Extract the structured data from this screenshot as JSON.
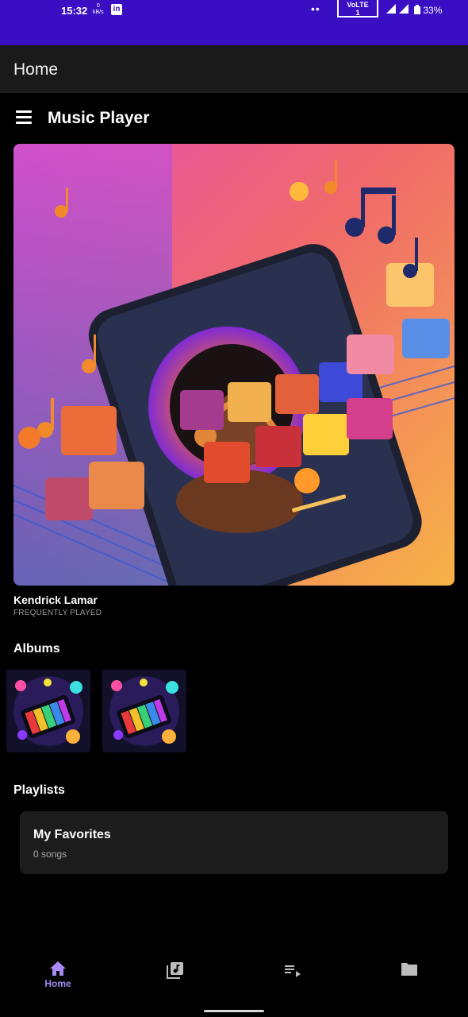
{
  "status_bar": {
    "time": "15:32",
    "net_speed_value": "0",
    "net_speed_unit": "kB/s",
    "app_icon": "linkedin-icon",
    "volte_label": "VoLTE",
    "volte_sim": "1",
    "battery": "33%",
    "color": "#3a0fc4"
  },
  "app_bar": {
    "title": "Home"
  },
  "header": {
    "menu_icon": "menu-icon",
    "title": "Music Player"
  },
  "featured": {
    "artist": "Kendrick Lamar",
    "subtitle": "FREQUENTLY PLAYED"
  },
  "albums": {
    "title": "Albums",
    "items": [
      {
        "cover": "album-art"
      },
      {
        "cover": "album-art"
      }
    ]
  },
  "playlists": {
    "title": "Playlists",
    "items": [
      {
        "name": "My Favorites",
        "count": "0 songs"
      }
    ]
  },
  "bottom_nav": {
    "items": [
      {
        "icon": "home-icon",
        "label": "Home",
        "active": true
      },
      {
        "icon": "library-music-icon",
        "label": "",
        "active": false
      },
      {
        "icon": "queue-icon",
        "label": "",
        "active": false
      },
      {
        "icon": "folder-icon",
        "label": "",
        "active": false
      }
    ],
    "active_color": "#a88bf5",
    "inactive_color": "#bdbdbd"
  }
}
